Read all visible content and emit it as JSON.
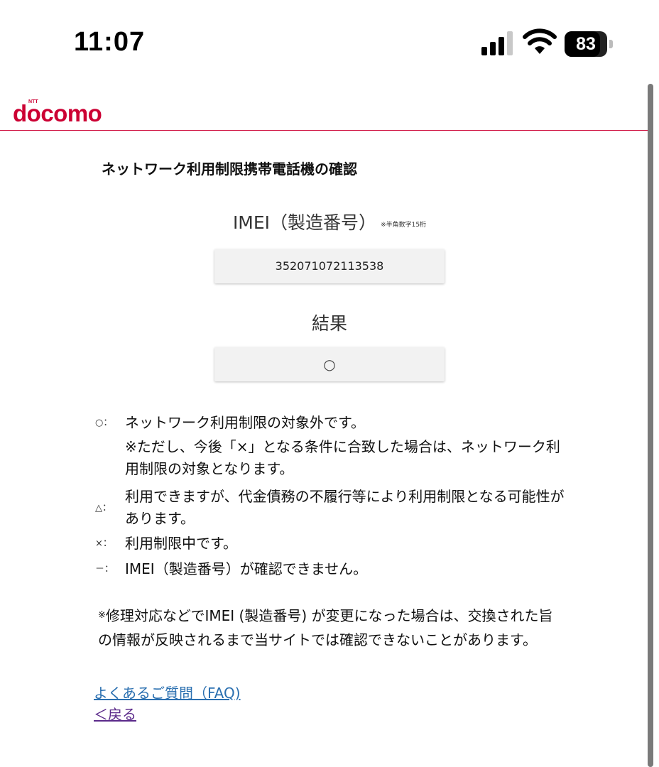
{
  "status_bar": {
    "time": "11:07",
    "battery_percent": "83",
    "battery_level": 0.83,
    "icons": [
      "signal-icon",
      "wifi-icon",
      "battery-icon"
    ]
  },
  "header": {
    "logo_text": "docomo",
    "logo_ntt": "NTT",
    "brand_color": "#cc0033"
  },
  "page": {
    "title": "ネットワーク利用制限携帯電話機の確認",
    "imei_label": "IMEI（製造番号）",
    "imei_note": "※半角数字15桁",
    "imei_value": "352071072113538",
    "result_label": "結果",
    "result_value": "○"
  },
  "legend": {
    "o_symbol": "○：",
    "o_text": "ネットワーク利用制限の対象外です。",
    "o_subtext": "※ただし、今後「×」となる条件に合致した場合は、ネットワーク利用制限の対象となります。",
    "t_symbol": "△：",
    "t_text": "利用できますが、代金債務の不履行等により利用制限となる可能性があります。",
    "x_symbol": "×：",
    "x_text": "利用制限中です。",
    "d_symbol": "－：",
    "d_text": "IMEI（製造番号）が確認できません。"
  },
  "remark": {
    "mark": "※",
    "text": "修理対応などでIMEI (製造番号) が変更になった場合は、交換された旨の情報が反映されるまで当サイトでは確認できないことがあります。"
  },
  "links": {
    "faq": "よくあるご質問（FAQ)",
    "back": "＜戻る"
  },
  "colors": {
    "link": "#2a6fb0",
    "visited_link": "#5b2a8a"
  }
}
